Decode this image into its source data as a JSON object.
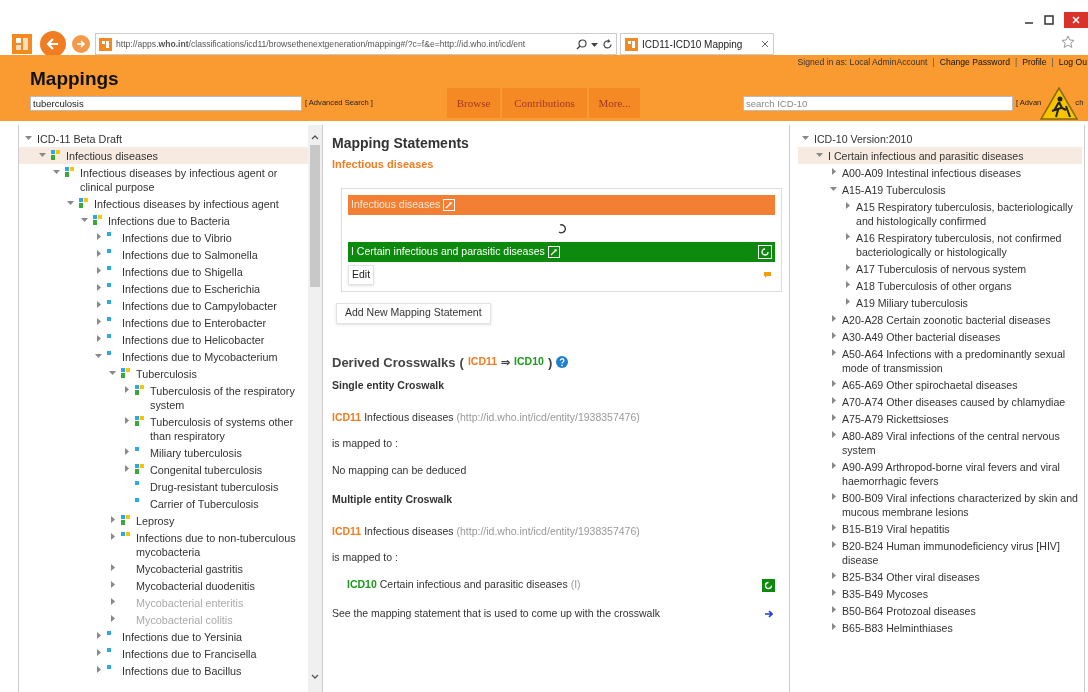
{
  "browser": {
    "url": "http://apps.**who.int**/classifications/icd11/browsethenextgeneration/mapping#/?c=f&e=http://id.who.int/icd/ent",
    "tab_title": "ICD11-ICD10 Mapping"
  },
  "header": {
    "title": "Mappings",
    "user_bar": [
      {
        "kind": "text",
        "text": "Signed in as: Local AdminAccount"
      },
      {
        "kind": "separator",
        "text": "|"
      },
      {
        "kind": "link",
        "text": "Change Password"
      },
      {
        "kind": "separator",
        "text": "|"
      },
      {
        "kind": "link",
        "text": "Profile"
      },
      {
        "kind": "separator",
        "text": "|"
      },
      {
        "kind": "link",
        "text": "Log Ou"
      }
    ],
    "search": {
      "value": "tuberculosis",
      "advanced": "[ Advanced Search ]"
    },
    "tabs": [
      {
        "label": "Browse"
      },
      {
        "label": "Contributions"
      },
      {
        "label": "More..."
      }
    ],
    "icd10_search": {
      "placeholder": "search ICD-10",
      "advanced_left": "[ Advan",
      "advanced_right": "ch"
    }
  },
  "left_tree": [
    {
      "label": "ICD-11 Beta Draft",
      "expanded": true,
      "selected": false,
      "children": [
        {
          "label": "Infectious diseases",
          "expanded": true,
          "selected": true,
          "kind": "multi",
          "children": [
            {
              "label": "Infectious diseases by infectious agent or clinical purpose",
              "expanded": true,
              "selected": false,
              "kind": "multi",
              "children": [
                {
                  "label": "Infectious diseases by infectious agent",
                  "expanded": true,
                  "selected": false,
                  "kind": "multi",
                  "children": [
                    {
                      "label": "Infections due to Bacteria",
                      "expanded": true,
                      "selected": false,
                      "kind": "multi",
                      "children": [
                        {
                          "label": "Infections due to Vibrio",
                          "expanded": false,
                          "selected": false,
                          "kind": "single"
                        },
                        {
                          "label": "Infections due to Salmonella",
                          "expanded": false,
                          "selected": false,
                          "kind": "single"
                        },
                        {
                          "label": "Infections due to Shigella",
                          "expanded": false,
                          "selected": false,
                          "kind": "single"
                        },
                        {
                          "label": "Infections due to Escherichia",
                          "expanded": false,
                          "selected": false,
                          "kind": "single"
                        },
                        {
                          "label": "Infections due to Campylobacter",
                          "expanded": false,
                          "selected": false,
                          "kind": "single"
                        },
                        {
                          "label": "Infections due to Enterobacter",
                          "expanded": false,
                          "selected": false,
                          "kind": "single"
                        },
                        {
                          "label": "Infections due to Helicobacter",
                          "expanded": false,
                          "selected": false,
                          "kind": "single"
                        },
                        {
                          "label": "Infections due to Mycobacterium",
                          "expanded": true,
                          "selected": false,
                          "kind": "single",
                          "children": [
                            {
                              "label": "Tuberculosis",
                              "expanded": true,
                              "selected": false,
                              "disabled": false,
                              "kind": "multi",
                              "children": [
                                {
                                  "label": "Tuberculosis of the respiratory system",
                                  "expanded": false,
                                  "selected": false,
                                  "kind": "multi"
                                },
                                {
                                  "label": "Tuberculosis of systems other than respiratory",
                                  "expanded": false,
                                  "selected": false,
                                  "kind": "multi"
                                },
                                {
                                  "label": "Miliary tuberculosis",
                                  "expanded": false,
                                  "selected": false,
                                  "kind": "single"
                                },
                                {
                                  "label": "Congenital tuberculosis",
                                  "expanded": false,
                                  "selected": false,
                                  "kind": "multi"
                                },
                                {
                                  "label": "Drug-resistant tuberculosis",
                                  "selected": false,
                                  "kind": "single"
                                },
                                {
                                  "label": "Carrier of Tuberculosis",
                                  "selected": false,
                                  "kind": "single"
                                }
                              ]
                            },
                            {
                              "label": "Leprosy",
                              "expanded": false,
                              "selected": false,
                              "disabled": false,
                              "kind": "multi"
                            },
                            {
                              "label": "Infections due to non-tuberculous mycobacteria",
                              "expanded": false,
                              "selected": false,
                              "disabled": false,
                              "kind": "pair"
                            },
                            {
                              "label": "Mycobacterial gastritis",
                              "expanded": false,
                              "selected": false,
                              "disabled": false,
                              "kind": "none"
                            },
                            {
                              "label": "Mycobacterial duodenitis",
                              "expanded": false,
                              "selected": false,
                              "disabled": false,
                              "kind": "none"
                            },
                            {
                              "label": "Mycobacterial enteritis",
                              "expanded": false,
                              "selected": false,
                              "disabled": true,
                              "kind": "none"
                            },
                            {
                              "label": "Mycobacterial colitis",
                              "expanded": false,
                              "selected": false,
                              "disabled": true,
                              "kind": "none"
                            }
                          ]
                        },
                        {
                          "label": "Infections due to Yersinia",
                          "expanded": false,
                          "selected": false,
                          "kind": "single"
                        },
                        {
                          "label": "Infections due to Francisella",
                          "expanded": false,
                          "selected": false,
                          "kind": "single"
                        },
                        {
                          "label": "Infections due to Bacillus",
                          "expanded": false,
                          "selected": false,
                          "kind": "single"
                        }
                      ]
                    }
                  ]
                }
              ]
            }
          ]
        }
      ]
    }
  ],
  "mapping": {
    "title": "Mapping Statements",
    "entity": "Infectious diseases",
    "statements": [
      {
        "source": "Infectious diseases",
        "target": "I Certain infectious and parasitic diseases",
        "edit": "Edit"
      }
    ],
    "add_button": "Add New Mapping Statement"
  },
  "crosswalks": {
    "title": "Derived Crosswalks",
    "open": "(",
    "from": "ICD11",
    "arrow": "⇒",
    "to": "ICD10",
    "close": ")",
    "sections": [
      {
        "heading": "Single entity Croswalk",
        "source": {
          "code": "ICD11",
          "label": "Infectious diseases",
          "uri": "(http://id.who.int/icd/entity/1938357476)"
        },
        "mapped_to": "is mapped to :",
        "result": {
          "kind": "none",
          "text": "No mapping can be deduced"
        }
      },
      {
        "heading": "Multiple entity Croswalk",
        "source": {
          "code": "ICD11",
          "label": "Infectious diseases",
          "uri": "(http://id.who.int/icd/entity/1938357476)"
        },
        "mapped_to": "is mapped to :",
        "result": {
          "kind": "target",
          "code": "ICD10",
          "label": "Certain infectious and parasitic diseases",
          "note": "(I)"
        },
        "footnote": "See the mapping statement that is used to come up with the crosswalk"
      }
    ]
  },
  "right_tree": [
    {
      "label": "ICD-10 Version:2010",
      "expanded": true,
      "selected": false,
      "children": [
        {
          "label": "I Certain infectious and parasitic diseases",
          "expanded": true,
          "selected": true,
          "children": [
            {
              "label": "A00-A09 Intestinal infectious diseases",
              "expanded": false,
              "selected": false
            },
            {
              "label": "A15-A19 Tuberculosis",
              "expanded": true,
              "selected": false,
              "children": [
                {
                  "label": "A15 Respiratory tuberculosis, bacteriologically and histologically confirmed",
                  "expanded": false,
                  "selected": false
                },
                {
                  "label": "A16 Respiratory tuberculosis, not confirmed bacteriologically or histologically",
                  "expanded": false,
                  "selected": false
                },
                {
                  "label": "A17 Tuberculosis of nervous system",
                  "expanded": false,
                  "selected": false
                },
                {
                  "label": "A18 Tuberculosis of other organs",
                  "expanded": false,
                  "selected": false
                },
                {
                  "label": "A19 Miliary tuberculosis",
                  "expanded": false,
                  "selected": false
                }
              ]
            },
            {
              "label": "A20-A28 Certain zoonotic bacterial diseases",
              "expanded": false,
              "selected": false
            },
            {
              "label": "A30-A49 Other bacterial diseases",
              "expanded": false,
              "selected": false
            },
            {
              "label": "A50-A64 Infections with a predominantly sexual mode of transmission",
              "expanded": false,
              "selected": false
            },
            {
              "label": "A65-A69 Other spirochaetal diseases",
              "expanded": false,
              "selected": false
            },
            {
              "label": "A70-A74 Other diseases caused by chlamydiae",
              "expanded": false,
              "selected": false
            },
            {
              "label": "A75-A79 Rickettsioses",
              "expanded": false,
              "selected": false
            },
            {
              "label": "A80-A89 Viral infections of the central nervous system",
              "expanded": false,
              "selected": false
            },
            {
              "label": "A90-A99 Arthropod-borne viral fevers and viral haemorrhagic fevers",
              "expanded": false,
              "selected": false
            },
            {
              "label": "B00-B09 Viral infections characterized by skin and mucous membrane lesions",
              "expanded": false,
              "selected": false
            },
            {
              "label": "B15-B19 Viral hepatitis",
              "expanded": false,
              "selected": false
            },
            {
              "label": "B20-B24 Human immunodeficiency virus [HIV] disease",
              "expanded": false,
              "selected": false
            },
            {
              "label": "B25-B34 Other viral diseases",
              "expanded": false,
              "selected": false
            },
            {
              "label": "B35-B49 Mycoses",
              "expanded": false,
              "selected": false
            },
            {
              "label": "B50-B64 Protozoal diseases",
              "expanded": false,
              "selected": false
            },
            {
              "label": "B65-B83 Helminthiases",
              "expanded": false,
              "selected": false
            }
          ]
        }
      ]
    }
  ]
}
